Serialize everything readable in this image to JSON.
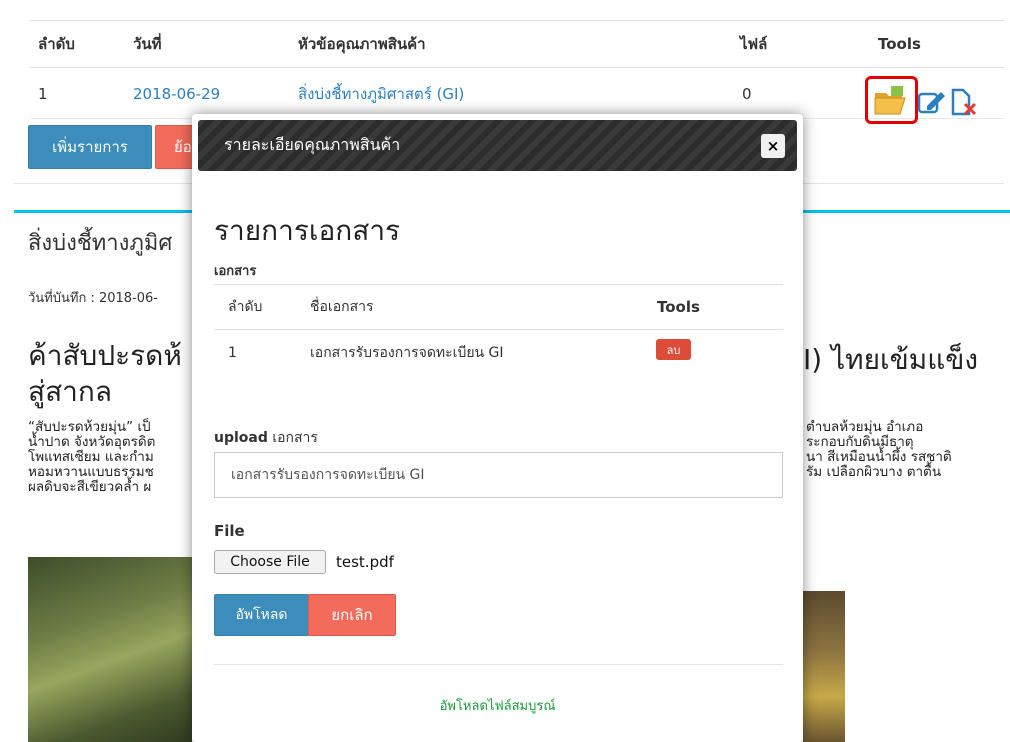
{
  "list_table": {
    "headers": [
      "ลำดับ",
      "วันที่",
      "หัวข้อคุณภาพสินค้า",
      "ไฟล์",
      "Tools"
    ],
    "rows": [
      {
        "index": "1",
        "date": "2018-06-29",
        "topic": "สิ่งบ่งชี้ทางภูมิศาสตร์ (GI)",
        "files": "0"
      }
    ],
    "tool_icons": [
      "folder-open-icon",
      "edit-icon",
      "delete-file-icon"
    ]
  },
  "buttons": {
    "add": "เพิ่มรายการ",
    "back_partial": "ย้อ"
  },
  "article": {
    "subtitle_partial": "สิ่งบ่งชี้ทางภูมิศ",
    "date_partial": "วันที่บันทึก : 2018-06-",
    "title_left": "ค้าสับปะรดห้",
    "title_right": "I) ไทยเข้มแข็ง",
    "title_line2": "สู่สากล",
    "para_left": [
      "“สับปะรดห้วยมุ่น” เป็",
      "น้ำปาด จังหวัดอุตรดิต",
      "โพแทสเซียม และกำม",
      "หอมหวานแบบธรรมช",
      "ผลดิบจะสีเขียวคล้ำ ผ"
    ],
    "para_right": [
      "ตำบลห้วยมุ่น อำเภอ",
      "ระกอบกับดินมีธาตุ",
      "นา สีเหมือนน้ำผึ้ง รสชาติ",
      "รัม เปลือกผิวบาง ตาตื้น"
    ]
  },
  "modal": {
    "title": "รายละเอียดคุณภาพสินค้า",
    "close_label": "×",
    "heading": "รายการเอกสาร",
    "section_label": "เอกสาร",
    "doc_table": {
      "headers": [
        "ลำดับ",
        "ชื่อเอกสาร",
        "Tools"
      ],
      "rows": [
        {
          "index": "1",
          "name": "เอกสารรับรองการจดทะเบียน GI",
          "action": "ลบ"
        }
      ]
    },
    "upload_label_bold": "upload",
    "upload_label_rest": " เอกสาร",
    "upload_input_value": "เอกสารรับรองการจดทะเบียน GI",
    "file_label": "File",
    "choose_file": "Choose File",
    "file_name": "test.pdf",
    "upload_button": "อัพโหลด",
    "cancel_button": "ยกเลิก",
    "success_message": "อัพโหลดไฟล์สมบูรณ์"
  },
  "colors": {
    "accent_blue": "#3c8dbc",
    "danger_red": "#f26b5b",
    "success_green": "#1a9c3a",
    "highlight": "#e30000"
  }
}
